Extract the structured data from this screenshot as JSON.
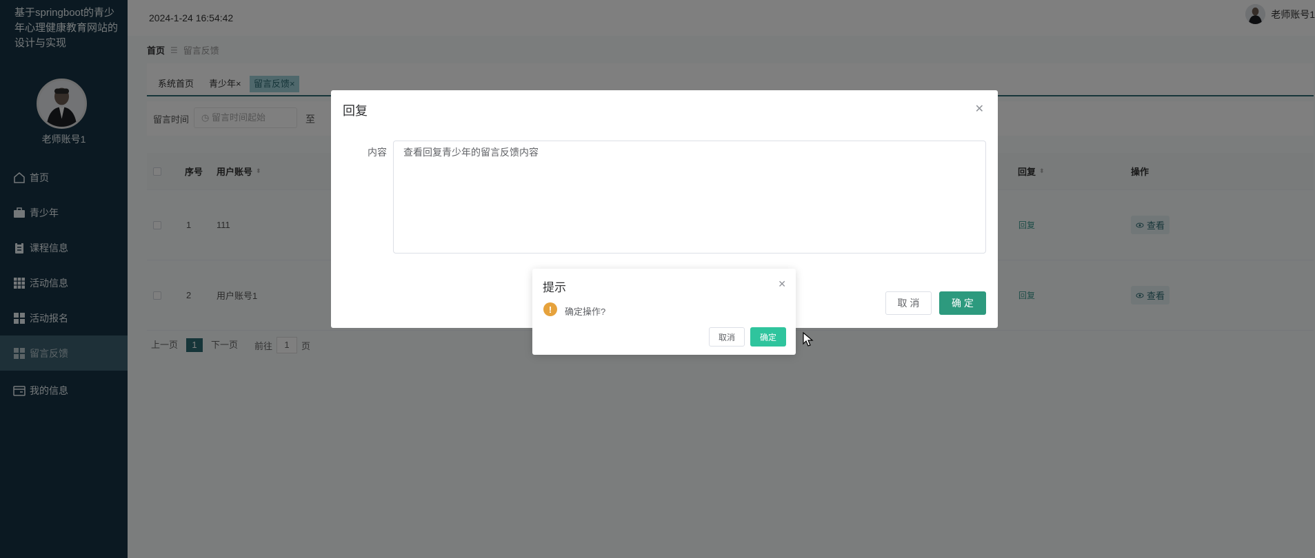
{
  "sidebar": {
    "title": "基于springboot的青少年心理健康教育网站的设计与实现",
    "username": "老师账号1",
    "menu": [
      {
        "label": "首页",
        "icon": "home-icon"
      },
      {
        "label": "青少年",
        "icon": "briefcase-icon"
      },
      {
        "label": "课程信息",
        "icon": "clipboard-icon"
      },
      {
        "label": "活动信息",
        "icon": "grid-icon"
      },
      {
        "label": "活动报名",
        "icon": "apps-icon"
      },
      {
        "label": "留言反馈",
        "icon": "apps-icon",
        "active": true
      },
      {
        "label": "我的信息",
        "icon": "card-icon"
      }
    ]
  },
  "header": {
    "datetime": "2024-1-24 16:54:42",
    "username": "老师账号1"
  },
  "breadcrumb": {
    "home": "首页",
    "current": "留言反馈"
  },
  "tags": [
    {
      "label": "系统首页"
    },
    {
      "label": "青少年×"
    },
    {
      "label": "留言反馈×",
      "active": true
    }
  ],
  "search": {
    "label": "留言时间",
    "start_placeholder": "留言时间起始",
    "to": "至"
  },
  "table": {
    "headers": {
      "index": "序号",
      "account": "用户账号",
      "reply": "回复",
      "action": "操作"
    },
    "rows": [
      {
        "index": "1",
        "account": "111",
        "reply": "回复",
        "action": "查看"
      },
      {
        "index": "2",
        "account": "用户账号1",
        "reply": "回复",
        "action": "查看"
      }
    ]
  },
  "pager": {
    "prev": "上一页",
    "current": "1",
    "next": "下一页",
    "goto": "前往",
    "goto_value": "1",
    "page_unit": "页"
  },
  "reply_dialog": {
    "title": "回复",
    "content_label": "内容",
    "content_value": "查看回复青少年的留言反馈内容",
    "cancel": "取 消",
    "ok": "确 定"
  },
  "confirm": {
    "title": "提示",
    "message": "确定操作?",
    "cancel": "取消",
    "ok": "确定"
  },
  "colors": {
    "sidebar_bg": "#173344",
    "accent": "#2d6b73",
    "confirm_ok": "#2fc49d",
    "warning": "#e6a23c"
  }
}
